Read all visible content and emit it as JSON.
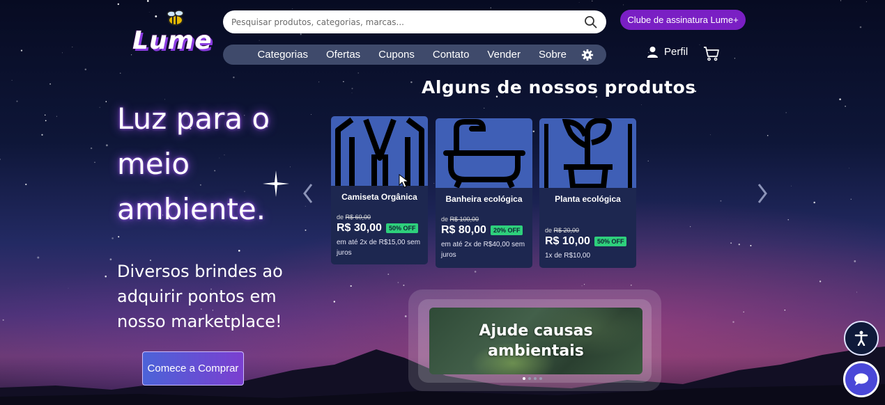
{
  "header": {
    "logo_text": "Lume",
    "search": {
      "placeholder": "Pesquisar produtos, categorias, marcas..."
    },
    "nav": [
      "Categorias",
      "Ofertas",
      "Cupons",
      "Contato",
      "Vender",
      "Sobre"
    ],
    "club_button": "Clube de assinatura Lume+",
    "profile_label": "Perfil"
  },
  "hero": {
    "title": "Luz para o meio ambiente.",
    "subtitle": "Diversos brindes ao adquirir pontos em nosso marketplace!",
    "cta": "Comece a Comprar"
  },
  "products": {
    "section_title": "Alguns de nossos produtos",
    "items": [
      {
        "name": "Camiseta Orgânica",
        "old_prefix": "de",
        "old_price": "R$ 60,00",
        "price": "R$ 30,00",
        "discount": "50% OFF",
        "installments": "em até 2x de R$15,00 sem juros",
        "icon": "shirt-icon"
      },
      {
        "name": "Banheira ecológica",
        "old_prefix": "de",
        "old_price": "R$ 100,00",
        "price": "R$ 80,00",
        "discount": "20% OFF",
        "installments": "em até 2x de R$40,00 sem juros",
        "icon": "bathtub-icon"
      },
      {
        "name": "Planta ecológica",
        "old_prefix": "de",
        "old_price": "R$ 20,00",
        "price": "R$ 10,00",
        "discount": "50% OFF",
        "installments": "1x de R$10,00",
        "icon": "plant-icon"
      }
    ]
  },
  "banner": {
    "text": "Ajude causas ambientais",
    "slides": 4,
    "active_slide": 1
  },
  "colors": {
    "accent": "#7a1fc4",
    "card_bg": "#1d2750",
    "product_image_bg": "#3f5fb6",
    "badge": "#2ed07c"
  }
}
